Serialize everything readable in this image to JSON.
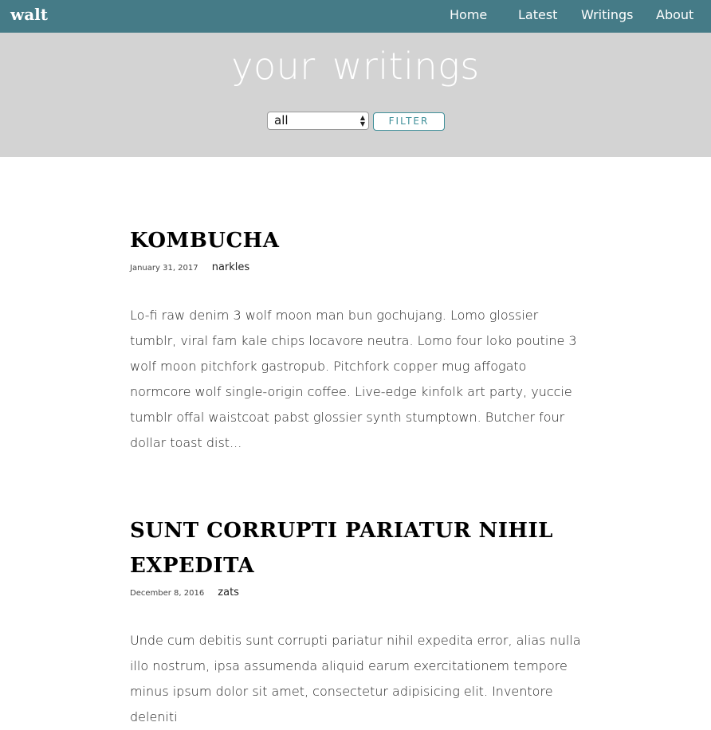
{
  "nav": {
    "brand": "walt",
    "links": [
      "Home",
      "Latest",
      "Writings",
      "About"
    ]
  },
  "hero": {
    "title": "your writings",
    "filter": {
      "selected": "all",
      "button_label": "FILTER"
    }
  },
  "posts": [
    {
      "title": "KOMBUCHA",
      "date": "January 31, 2017",
      "author": "narkles",
      "excerpt": "Lo-fi raw denim 3 wolf moon man bun gochujang. Lomo glossier tumblr, viral fam kale chips locavore neutra. Lomo four loko poutine 3 wolf moon pitchfork gastropub. Pitchfork copper mug affogato normcore wolf single-origin coffee. Live-edge kinfolk art party, yuccie tumblr offal waistcoat pabst glossier synth stumptown. Butcher four dollar toast dist..."
    },
    {
      "title": "SUNT CORRUPTI PARIATUR NIHIL EXPEDITA",
      "date": "December 8, 2016",
      "author": "zats",
      "excerpt": "Unde cum debitis sunt corrupti pariatur nihil expedita error, alias nulla illo nostrum, ipsa assumenda aliquid earum exercitationem tempore minus ipsum dolor sit amet, consectetur adipisicing elit. Inventore deleniti"
    }
  ],
  "colors": {
    "navbar": "#457b87",
    "hero_bg": "#d3d3d3",
    "accent": "#3f8f99"
  }
}
